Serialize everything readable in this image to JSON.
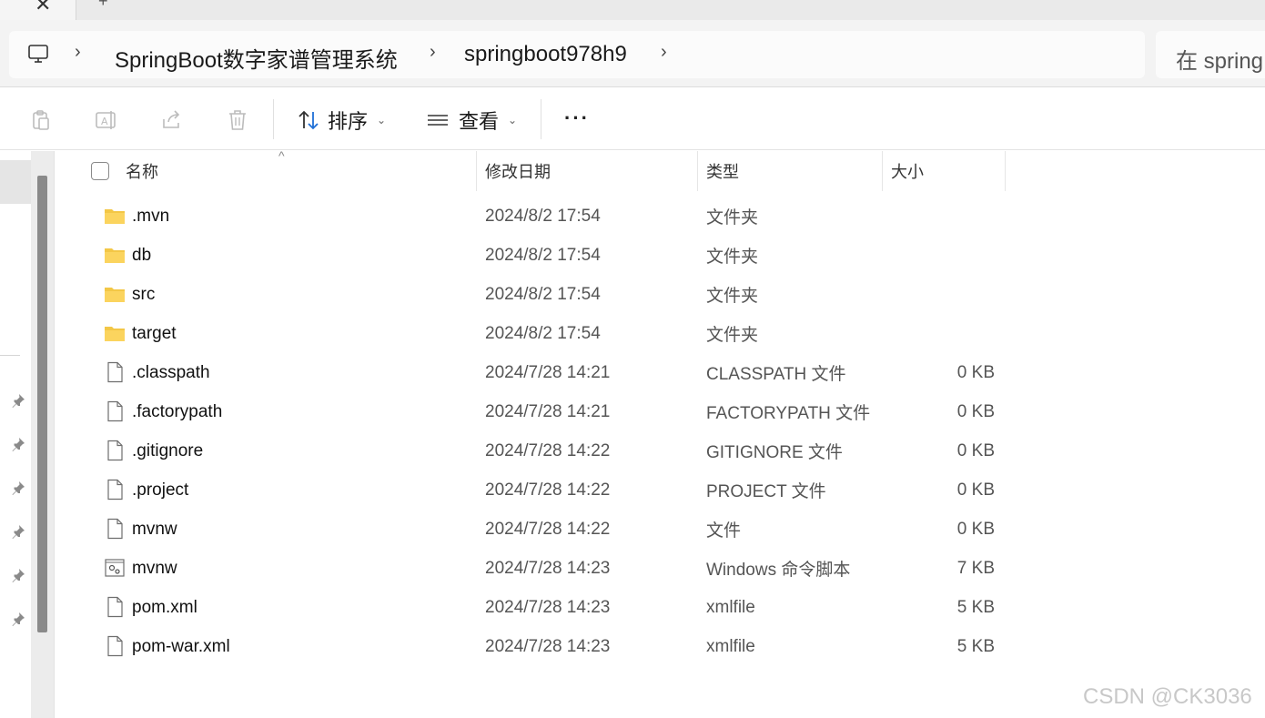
{
  "tabstrip": {
    "close_glyph": "✕",
    "new_tab_glyph": "+"
  },
  "address": {
    "crumbs": [
      "SpringBoot数字家谱管理系统",
      "springboot978h9"
    ],
    "search_placeholder": "在 spring"
  },
  "toolbar": {
    "sort_label": "排序",
    "view_label": "查看",
    "more_label": "···"
  },
  "columns": {
    "name": "名称",
    "modified": "修改日期",
    "type": "类型",
    "size": "大小"
  },
  "files": [
    {
      "name": ".mvn",
      "modified": "2024/8/2 17:54",
      "type": "文件夹",
      "size": "",
      "icon": "folder-icon"
    },
    {
      "name": "db",
      "modified": "2024/8/2 17:54",
      "type": "文件夹",
      "size": "",
      "icon": "folder-icon"
    },
    {
      "name": "src",
      "modified": "2024/8/2 17:54",
      "type": "文件夹",
      "size": "",
      "icon": "folder-icon"
    },
    {
      "name": "target",
      "modified": "2024/8/2 17:54",
      "type": "文件夹",
      "size": "",
      "icon": "folder-icon"
    },
    {
      "name": ".classpath",
      "modified": "2024/7/28 14:21",
      "type": "CLASSPATH 文件",
      "size": "0 KB",
      "icon": "file-icon"
    },
    {
      "name": ".factorypath",
      "modified": "2024/7/28 14:21",
      "type": "FACTORYPATH 文件",
      "size": "0 KB",
      "icon": "file-icon"
    },
    {
      "name": ".gitignore",
      "modified": "2024/7/28 14:22",
      "type": "GITIGNORE 文件",
      "size": "0 KB",
      "icon": "file-icon"
    },
    {
      "name": ".project",
      "modified": "2024/7/28 14:22",
      "type": "PROJECT 文件",
      "size": "0 KB",
      "icon": "file-icon"
    },
    {
      "name": "mvnw",
      "modified": "2024/7/28 14:22",
      "type": "文件",
      "size": "0 KB",
      "icon": "file-icon"
    },
    {
      "name": "mvnw",
      "modified": "2024/7/28 14:23",
      "type": "Windows 命令脚本",
      "size": "7 KB",
      "icon": "script-icon"
    },
    {
      "name": "pom.xml",
      "modified": "2024/7/28 14:23",
      "type": "xmlfile",
      "size": "5 KB",
      "icon": "file-icon"
    },
    {
      "name": "pom-war.xml",
      "modified": "2024/7/28 14:23",
      "type": "xmlfile",
      "size": "5 KB",
      "icon": "file-icon"
    }
  ],
  "watermark": "CSDN @CK3036"
}
